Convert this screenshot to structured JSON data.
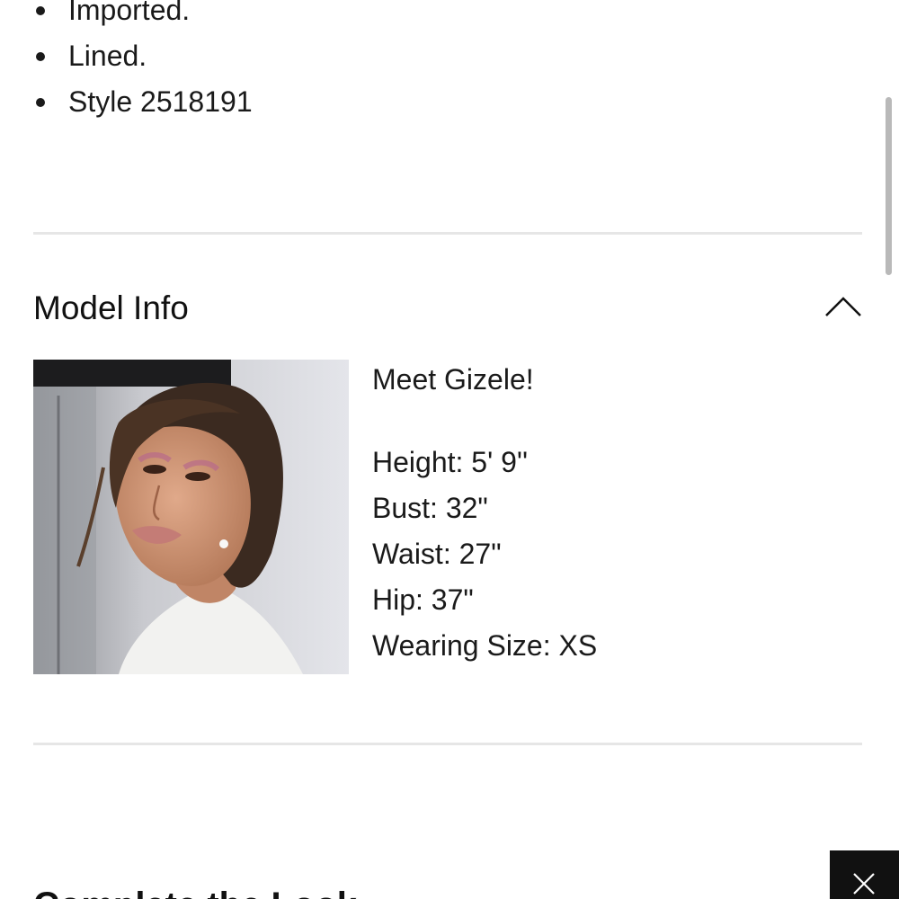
{
  "details": {
    "items": [
      "Imported.",
      "Lined.",
      "Style 2518191"
    ]
  },
  "model_info": {
    "title": "Model Info",
    "toggle_icon": "chevron-up-icon",
    "photo_alt": "model photo",
    "intro": "Meet Gizele!",
    "stats": {
      "height": "Height: 5' 9''",
      "bust": "Bust: 32\"",
      "waist": "Waist: 27\"",
      "hip": "Hip: 37\"",
      "size": "Wearing Size: XS"
    }
  },
  "next_section": {
    "heading": "Complete the Look"
  },
  "close_button": {
    "icon": "close-icon"
  },
  "colors": {
    "text": "#1a1a1a",
    "divider": "#e6e6e6",
    "close_bg": "#111111",
    "scrollbar": "#b9b9b9"
  }
}
